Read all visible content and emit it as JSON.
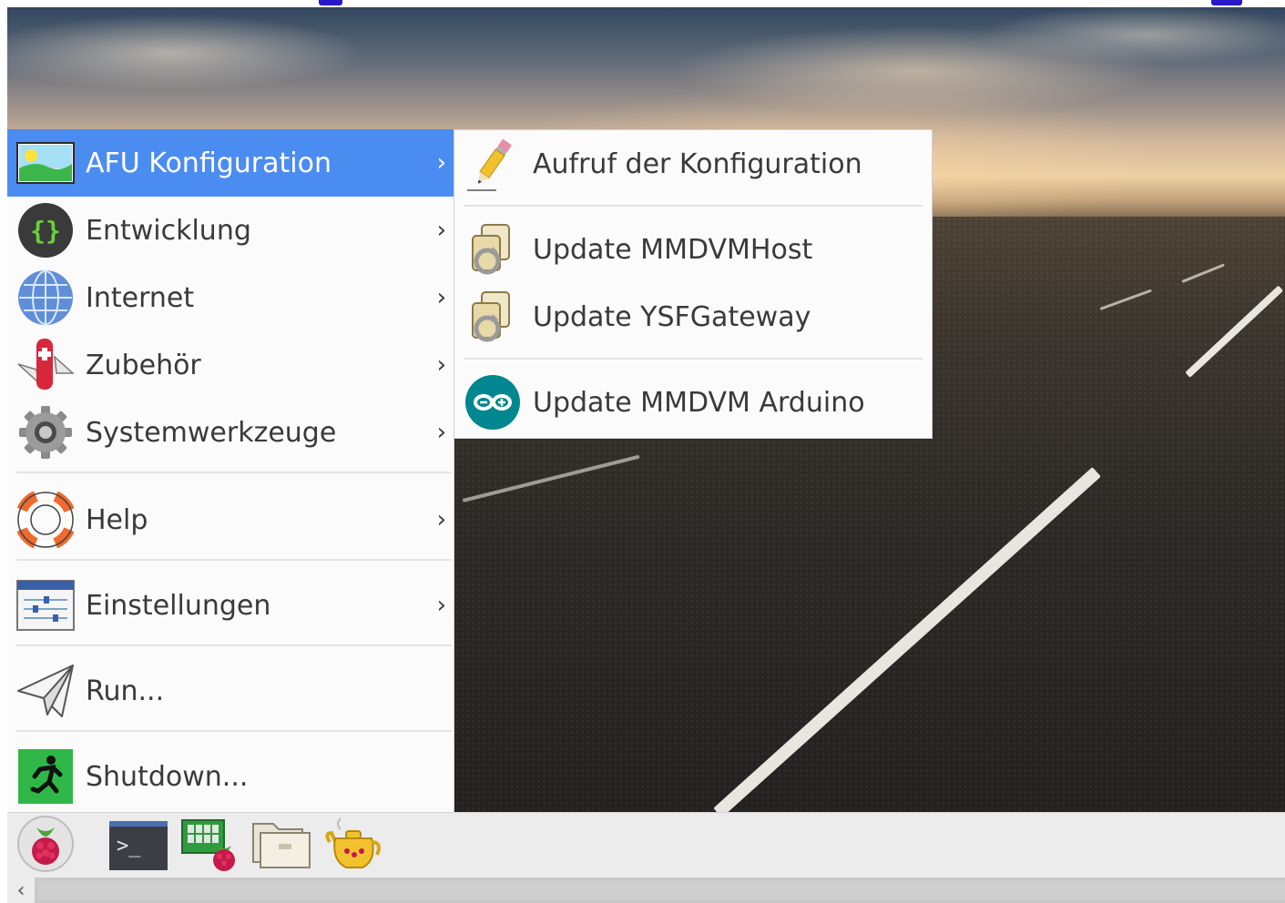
{
  "main_menu": {
    "items": [
      {
        "label": "AFU Konfiguration",
        "icon": "landscape-image-icon",
        "selected": true,
        "submenu": true
      },
      {
        "label": "Entwicklung",
        "icon": "code-braces-icon",
        "selected": false,
        "submenu": true
      },
      {
        "label": "Internet",
        "icon": "globe-icon",
        "selected": false,
        "submenu": true
      },
      {
        "label": "Zubehör",
        "icon": "pocket-knife-icon",
        "selected": false,
        "submenu": true
      },
      {
        "label": "Systemwerkzeuge",
        "icon": "gear-icon",
        "selected": false,
        "submenu": true
      },
      {
        "label": "Help",
        "icon": "lifebuoy-icon",
        "selected": false,
        "submenu": true
      },
      {
        "label": "Einstellungen",
        "icon": "settings-sliders-icon",
        "selected": false,
        "submenu": true
      },
      {
        "label": "Run...",
        "icon": "paper-plane-icon",
        "selected": false,
        "submenu": false
      },
      {
        "label": "Shutdown...",
        "icon": "exit-running-man-icon",
        "selected": false,
        "submenu": false
      }
    ],
    "arrow_glyph": "›"
  },
  "sub_menu": {
    "items": [
      {
        "label": "Aufruf der Konfiguration",
        "icon": "pencil-icon"
      },
      {
        "label": "Update MMDVMHost",
        "icon": "update-script-icon"
      },
      {
        "label": "Update YSFGateway",
        "icon": "update-script-icon"
      },
      {
        "label": "Update MMDVM Arduino",
        "icon": "arduino-icon"
      }
    ]
  },
  "taskbar": {
    "buttons": [
      {
        "icon": "raspberry-menu-icon"
      },
      {
        "icon": "terminal-icon"
      },
      {
        "icon": "raspberry-config-icon"
      },
      {
        "icon": "file-manager-folder-icon"
      },
      {
        "icon": "teapot-icon"
      }
    ],
    "terminal_prompt": ">_"
  },
  "scrollbar": {
    "left_arrow": "‹"
  },
  "colors": {
    "selection_blue": "#4b8cf0",
    "menu_bg": "#fbfbfb",
    "taskbar_bg": "#ececec",
    "banner_text_blue": "#2a17c8"
  }
}
